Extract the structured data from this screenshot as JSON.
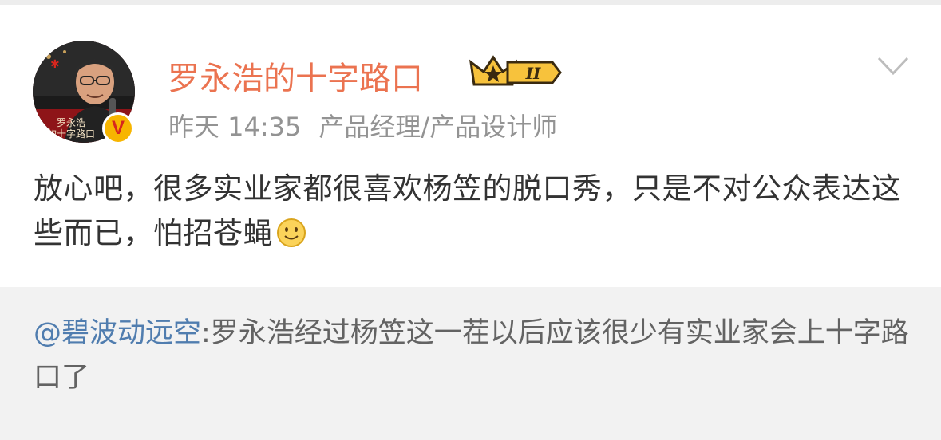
{
  "post": {
    "avatar_text_line1": "罗永浩",
    "avatar_text_line2": "的十字路口",
    "verified_mark": "V",
    "username": "罗永浩的十字路口",
    "vip_level": "II",
    "time": "昨天 14:35",
    "tagline": "产品经理/产品设计师",
    "text": "放心吧，很多实业家都很喜欢杨笠的脱口秀，只是不对公众表达这些而已，怕招苍蝇",
    "emoji_icon": "smile-emoji"
  },
  "repost": {
    "mention": "@碧波动远空",
    "text": ":罗永浩经过杨笠这一茬以后应该很少有实业家会上十字路口了"
  },
  "colors": {
    "username": "#eb7350",
    "meta": "#939393",
    "body": "#333333",
    "mention": "#507daf",
    "repost_bg": "#f2f2f2"
  }
}
